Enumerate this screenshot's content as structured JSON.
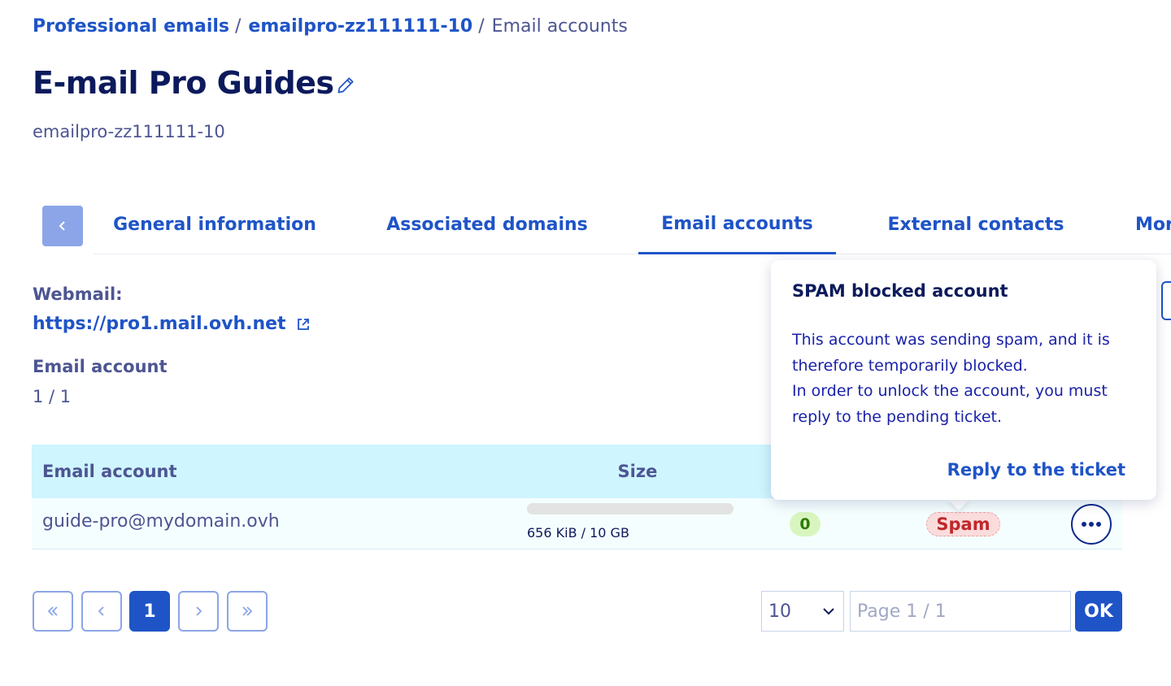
{
  "breadcrumb": {
    "items": [
      "Professional emails",
      "emailpro-zz111111-10"
    ],
    "separator": "/",
    "current": "Email accounts"
  },
  "header": {
    "title": "E-mail Pro Guides",
    "subtitle": "emailpro-zz111111-10",
    "edit_icon": "pencil-icon"
  },
  "tabs": {
    "back_icon": "chevron-left-icon",
    "items": [
      {
        "label": "General information",
        "active": false
      },
      {
        "label": "Associated domains",
        "active": false
      },
      {
        "label": "Email accounts",
        "active": true
      },
      {
        "label": "External contacts",
        "active": false
      },
      {
        "label": "Mor",
        "active": false
      }
    ]
  },
  "info": {
    "webmail_label": "Webmail:",
    "webmail_url": "https://pro1.mail.ovh.net",
    "external_link_icon": "external-link-icon",
    "account_label": "Email account",
    "account_count": "1 / 1"
  },
  "table": {
    "headers": {
      "email": "Email account",
      "size": "Size"
    },
    "rows": [
      {
        "email": "guide-pro@mydomain.ovh",
        "size_text": "656 KiB / 10 GB",
        "usage_fraction": 0.0001,
        "count": "0",
        "status": "Spam",
        "menu_icon": "more-horizontal-icon"
      }
    ]
  },
  "popover": {
    "title": "SPAM blocked account",
    "body_line1": "This account was sending spam, and it is therefore temporarily blocked.",
    "body_line2": "In order to unlock the account, you must reply to the pending ticket.",
    "link": "Reply to the ticket"
  },
  "pagination": {
    "first_icon": "double-chevron-left-icon",
    "prev_icon": "chevron-left-icon",
    "current_page": "1",
    "next_icon": "chevron-right-icon",
    "last_icon": "double-chevron-right-icon",
    "page_size": "10",
    "page_input_placeholder": "Page 1 / 1",
    "ok_label": "OK"
  },
  "colors": {
    "primary": "#1f54c7",
    "text": "#4d5592",
    "title": "#0c1a5c",
    "table_header_bg": "#cff5ff",
    "spam_badge": "#fbdcdc",
    "count_badge": "#d9f5bf"
  }
}
